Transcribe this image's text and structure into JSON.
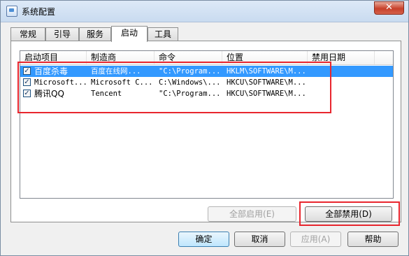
{
  "window": {
    "title": "系统配置",
    "close_label": "✕"
  },
  "tabs": [
    {
      "label": "常规",
      "active": false
    },
    {
      "label": "引导",
      "active": false
    },
    {
      "label": "服务",
      "active": false
    },
    {
      "label": "启动",
      "active": true
    },
    {
      "label": "工具",
      "active": false
    }
  ],
  "startup": {
    "columns": [
      "启动项目",
      "制造商",
      "命令",
      "位置",
      "禁用日期"
    ],
    "rows": [
      {
        "checked": true,
        "item": "百度杀毒",
        "maker": "百度在线网...",
        "command": "\"C:\\Program...",
        "location": "HKLM\\SOFTWARE\\M...",
        "disabled_date": ""
      },
      {
        "checked": true,
        "item": "Microsoft...",
        "maker": "Microsoft C...",
        "command": "C:\\Windows\\...",
        "location": "HKCU\\SOFTWARE\\M...",
        "disabled_date": ""
      },
      {
        "checked": true,
        "item": "腾讯QQ",
        "maker": "Tencent",
        "command": "\"C:\\Program...",
        "location": "HKCU\\SOFTWARE\\M...",
        "disabled_date": ""
      }
    ],
    "enable_all_label": "全部启用(E)",
    "disable_all_label": "全部禁用(D)"
  },
  "footer": {
    "ok_label": "确定",
    "cancel_label": "取消",
    "apply_label": "应用(A)",
    "help_label": "帮助"
  },
  "colors": {
    "selection": "#3399ff",
    "highlight_annotation": "#e8262e"
  }
}
